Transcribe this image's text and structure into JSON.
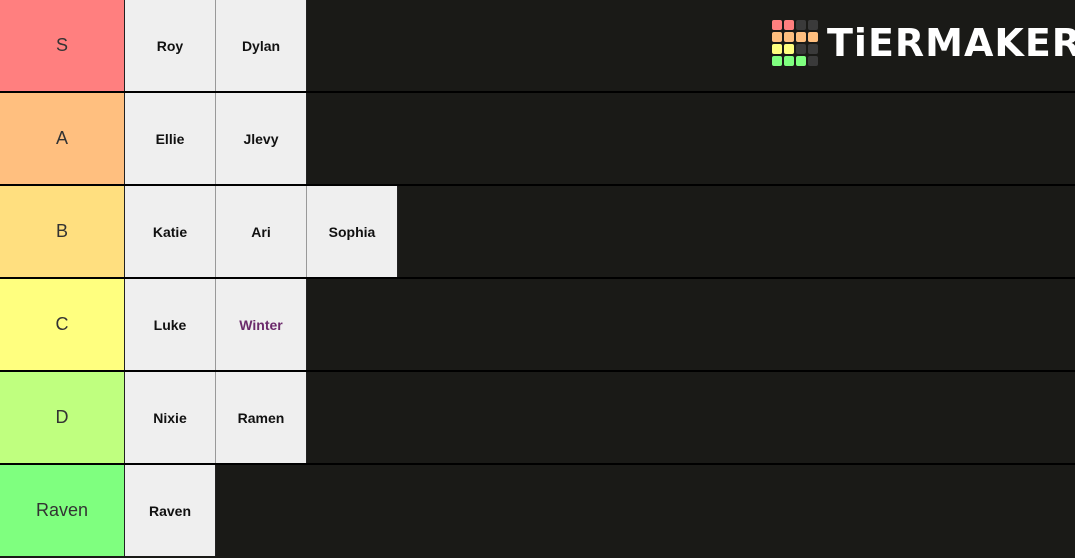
{
  "logo": {
    "text": "TiERMAKER",
    "grid_colors": [
      "#ff7f7f",
      "#ff7f7f",
      "#3a3a3a",
      "#3a3a3a",
      "#ffbf7f",
      "#ffbf7f",
      "#ffbf7f",
      "#ffbf7f",
      "#ffff7f",
      "#ffff7f",
      "#3a3a3a",
      "#3a3a3a",
      "#7fff7f",
      "#7fff7f",
      "#7fff7f",
      "#3a3a3a"
    ]
  },
  "tiers": [
    {
      "label": "S",
      "color": "#ff7f7f",
      "items": [
        {
          "name": "Roy"
        },
        {
          "name": "Dylan"
        }
      ]
    },
    {
      "label": "A",
      "color": "#ffbf7f",
      "items": [
        {
          "name": "Ellie"
        },
        {
          "name": "Jlevy"
        }
      ]
    },
    {
      "label": "B",
      "color": "#ffdf7f",
      "items": [
        {
          "name": "Katie"
        },
        {
          "name": "Ari"
        },
        {
          "name": "Sophia"
        }
      ]
    },
    {
      "label": "C",
      "color": "#ffff7f",
      "items": [
        {
          "name": "Luke"
        },
        {
          "name": "Winter",
          "color": "#6b2a6b"
        }
      ]
    },
    {
      "label": "D",
      "color": "#bfff7f",
      "items": [
        {
          "name": "Nixie"
        },
        {
          "name": "Ramen"
        }
      ]
    },
    {
      "label": "Raven",
      "color": "#7fff7f",
      "items": [
        {
          "name": "Raven"
        }
      ]
    }
  ]
}
